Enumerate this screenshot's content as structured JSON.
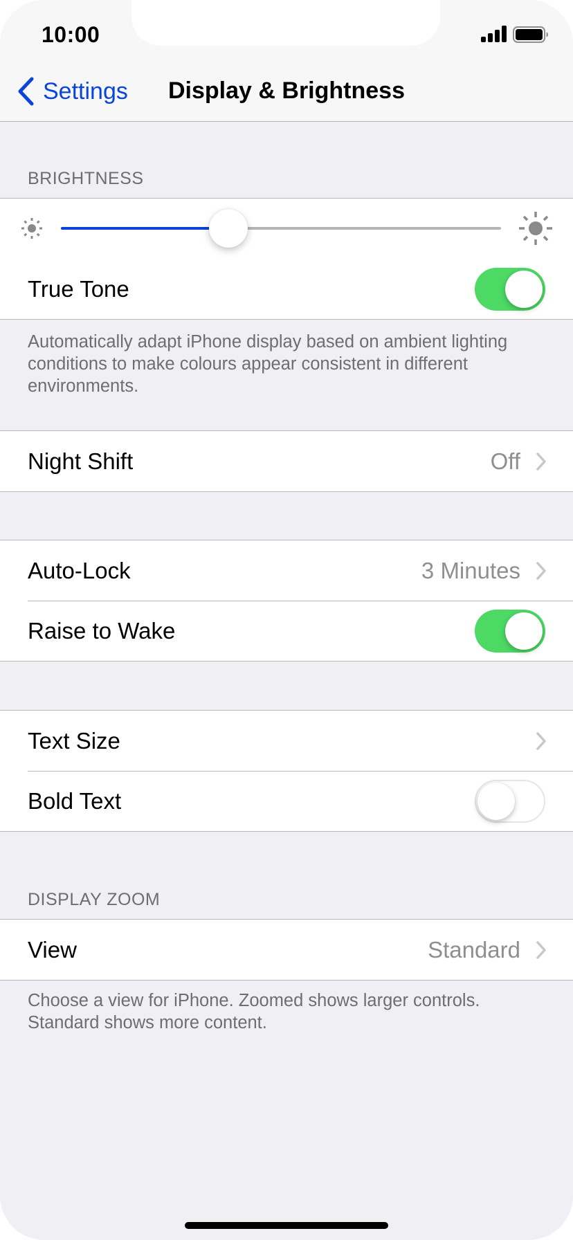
{
  "status_bar": {
    "time": "10:00",
    "signal_icon": "cellular-signal-icon",
    "battery_icon": "battery-full-icon"
  },
  "nav": {
    "back_label": "Settings",
    "back_icon": "chevron-left-icon",
    "title": "Display & Brightness"
  },
  "brightness": {
    "header": "BRIGHTNESS",
    "slider_value": 0.38,
    "min_icon": "sun-small-icon",
    "max_icon": "sun-large-icon",
    "true_tone": {
      "label": "True Tone",
      "on": true
    },
    "footer": "Automatically adapt iPhone display based on ambient lighting conditions to make colours appear consistent in different environments."
  },
  "night_shift": {
    "label": "Night Shift",
    "value": "Off"
  },
  "lock": {
    "auto_lock": {
      "label": "Auto-Lock",
      "value": "3 Minutes"
    },
    "raise_to_wake": {
      "label": "Raise to Wake",
      "on": true
    }
  },
  "text": {
    "text_size": {
      "label": "Text Size"
    },
    "bold_text": {
      "label": "Bold Text",
      "on": false
    }
  },
  "display_zoom": {
    "header": "DISPLAY ZOOM",
    "view": {
      "label": "View",
      "value": "Standard"
    },
    "footer": "Choose a view for iPhone. Zoomed shows larger controls. Standard shows more content."
  },
  "colors": {
    "accent": "#0a44d8",
    "toggle_on": "#4cd964",
    "background": "#efeff4",
    "secondary_text": "#8e8e93"
  }
}
